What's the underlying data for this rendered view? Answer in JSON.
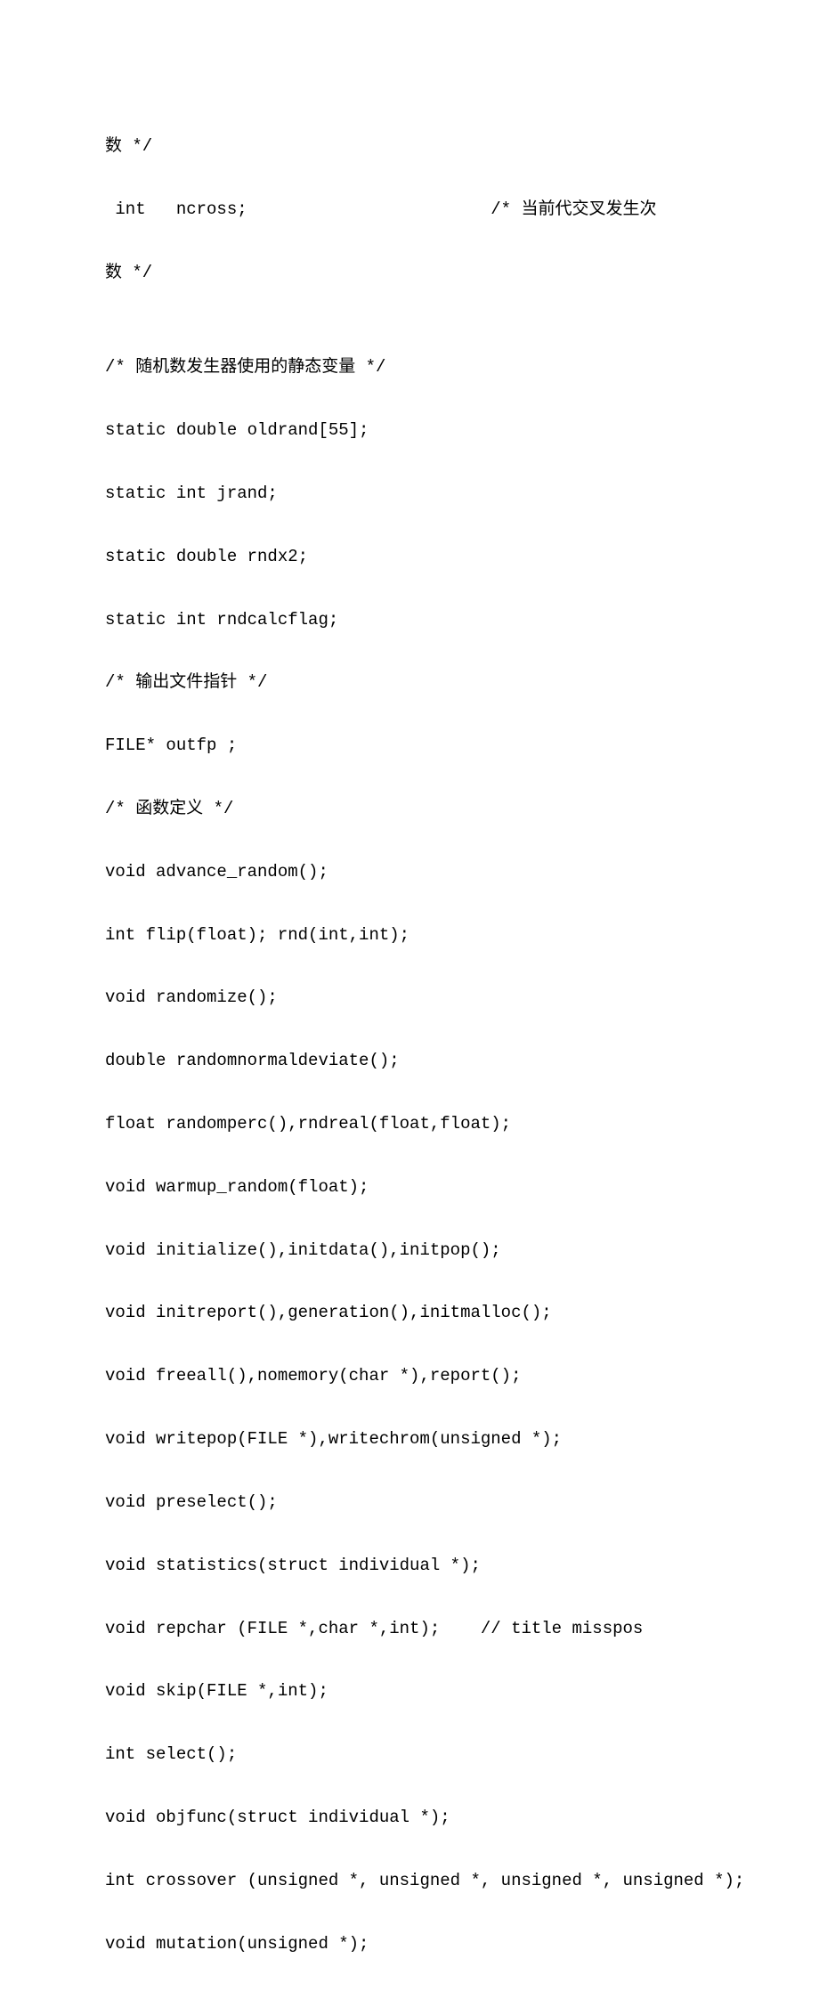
{
  "lines": [
    "数 */",
    " int   ncross;                        /* 当前代交叉发生次",
    "数 */",
    "",
    "/* 随机数发生器使用的静态变量 */",
    "static double oldrand[55];",
    "static int jrand;",
    "static double rndx2;",
    "static int rndcalcflag;",
    "/* 输出文件指针 */",
    "FILE* outfp ;",
    "/* 函数定义 */",
    "void advance_random();",
    "int flip(float); rnd(int,int);",
    "void randomize();",
    "double randomnormaldeviate();",
    "float randomperc(),rndreal(float,float);",
    "void warmup_random(float);",
    "void initialize(),initdata(),initpop();",
    "void initreport(),generation(),initmalloc();",
    "void freeall(),nomemory(char *),report();",
    "void writepop(FILE *),writechrom(unsigned *);",
    "void preselect();",
    "void statistics(struct individual *);",
    "void repchar (FILE *,char *,int);    // title misspos",
    "void skip(FILE *,int);",
    "int select();",
    "void objfunc(struct individual *);",
    "int crossover (unsigned *, unsigned *, unsigned *, unsigned *);",
    "void mutation(unsigned *);"
  ]
}
